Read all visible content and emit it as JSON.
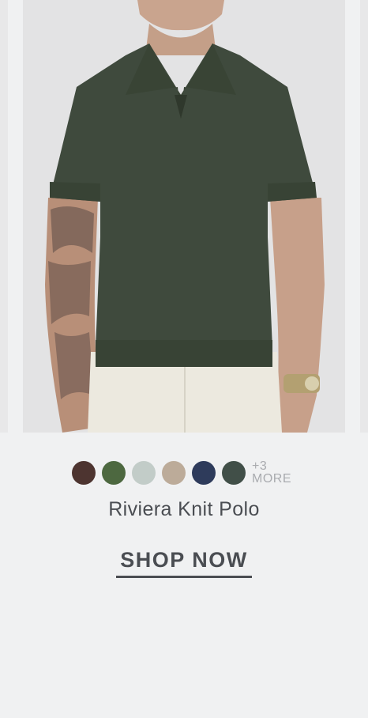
{
  "product": {
    "name": "Riviera Knit Polo",
    "image_alt": "Model wearing olive knit polo",
    "more_count": "+3",
    "more_label": "MORE",
    "cta_label": "SHOP NOW"
  },
  "swatches": [
    {
      "name": "brown",
      "color": "#4d3430"
    },
    {
      "name": "green",
      "color": "#4d6840"
    },
    {
      "name": "sage",
      "color": "#c2ccc8"
    },
    {
      "name": "taupe",
      "color": "#bcab99"
    },
    {
      "name": "navy",
      "color": "#2e3b5b"
    },
    {
      "name": "charcoal-green",
      "color": "#414f48"
    }
  ],
  "colors": {
    "background": "#f0f1f2",
    "text": "#4a4d52",
    "muted": "#a9abaf"
  }
}
